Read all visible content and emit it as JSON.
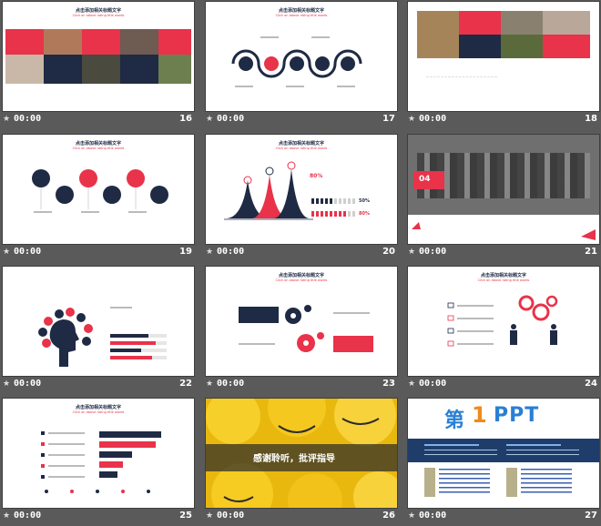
{
  "slides": [
    {
      "num": "16",
      "time": "00:00"
    },
    {
      "num": "17",
      "time": "00:00"
    },
    {
      "num": "18",
      "time": "00:00"
    },
    {
      "num": "19",
      "time": "00:00"
    },
    {
      "num": "20",
      "time": "00:00"
    },
    {
      "num": "21",
      "time": "00:00"
    },
    {
      "num": "22",
      "time": "00:00"
    },
    {
      "num": "23",
      "time": "00:00"
    },
    {
      "num": "24",
      "time": "00:00"
    },
    {
      "num": "25",
      "time": "00:00"
    },
    {
      "num": "26",
      "time": "00:00"
    },
    {
      "num": "27",
      "time": "00:00"
    }
  ],
  "content": {
    "slide_title": "点击添加相关标题文字",
    "slide_subtitle": "Click on above rating title words",
    "pct_80": "80%",
    "pct_50a": "50%",
    "pct_50b": "80%",
    "section_num": "04",
    "thanks": "感谢聆听，批评指导",
    "ppt_logo_a": "第",
    "ppt_logo_b": "1",
    "ppt_logo_c": "PPT"
  },
  "colors": {
    "navy": "#1f2a44",
    "red": "#e8334a",
    "grey": "#cfcfcf",
    "yellow": "#f2c21a"
  },
  "icons": {
    "star": "star-icon"
  }
}
